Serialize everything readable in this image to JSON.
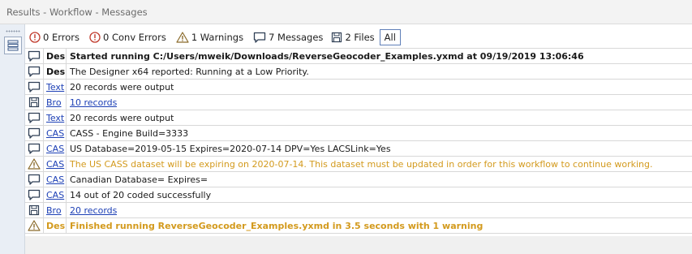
{
  "window": {
    "title": "Results - Workflow - Messages"
  },
  "toolbar": {
    "errors": "0 Errors",
    "conv_errors": "0 Conv Errors",
    "warnings": "1 Warnings",
    "messages": "7 Messages",
    "files": "2 Files",
    "all": "All"
  },
  "rows": [
    {
      "icon": "message-icon",
      "tool": "Des",
      "text": "Started running C:/Users/mweik/Downloads/ReverseGeocoder_Examples.yxmd at 09/19/2019 13:06:46"
    },
    {
      "icon": "message-icon",
      "tool": "Des",
      "text": "The Designer x64 reported: Running at a Low Priority."
    },
    {
      "icon": "message-icon",
      "tool": "Text",
      "text": "20 records were output"
    },
    {
      "icon": "file-icon",
      "tool": "Bro",
      "text": "10 records"
    },
    {
      "icon": "message-icon",
      "tool": "Text",
      "text": "20 records were output"
    },
    {
      "icon": "message-icon",
      "tool": "CAS",
      "text": "CASS - Engine Build=3333"
    },
    {
      "icon": "message-icon",
      "tool": "CAS",
      "text": "US Database=2019-05-15 Expires=2020-07-14 DPV=Yes LACSLink=Yes"
    },
    {
      "icon": "warning-icon",
      "tool": "CAS",
      "text": "The US CASS dataset will be expiring on 2020-07-14. This dataset must be updated in order for this workflow to continue working."
    },
    {
      "icon": "message-icon",
      "tool": "CAS",
      "text": "Canadian Database= Expires="
    },
    {
      "icon": "message-icon",
      "tool": "CAS",
      "text": "14 out of 20 coded successfully"
    },
    {
      "icon": "file-icon",
      "tool": "Bro",
      "text": "20 records"
    },
    {
      "icon": "warning-icon",
      "tool": "Des",
      "text": "Finished running ReverseGeocoder_Examples.yxmd in 3.5 seconds with 1 warning"
    }
  ],
  "colors": {
    "warning": "#d39a1d",
    "link": "#1c3fb5",
    "error": "#c0392b"
  }
}
